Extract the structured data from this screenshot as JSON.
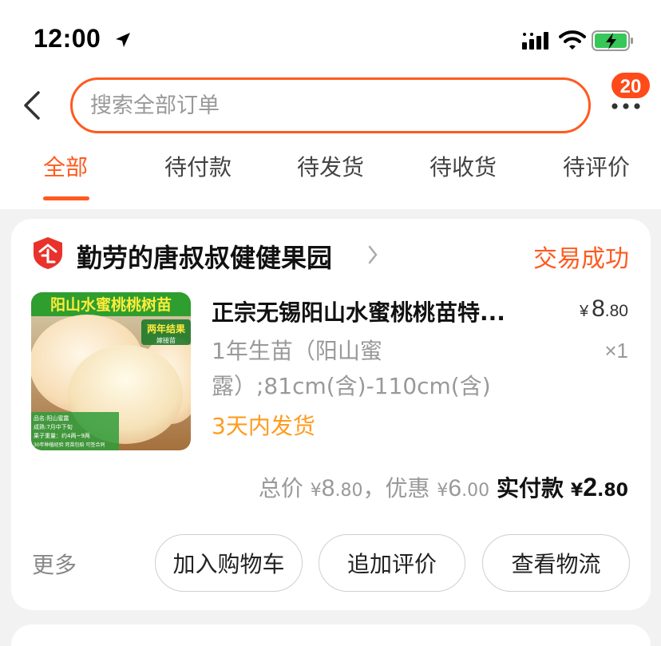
{
  "status_bar": {
    "time": "12:00"
  },
  "header": {
    "search_placeholder": "搜索全部订单",
    "badge_count": "20"
  },
  "tabs": [
    {
      "label": "全部",
      "active": true
    },
    {
      "label": "待付款",
      "active": false
    },
    {
      "label": "待发货",
      "active": false
    },
    {
      "label": "待收货",
      "active": false
    },
    {
      "label": "待评价",
      "active": false
    }
  ],
  "order": {
    "shop_name": "勤劳的唐叔叔健健果园",
    "status": "交易成功",
    "product": {
      "image_banner": "阳山水蜜桃桃树苗",
      "image_tag": "两年结果",
      "image_subtag": "嫁接苗",
      "image_info": [
        "品名:阳山蜜露",
        "成熟:7月中下旬",
        "果子重量：约4两~9两",
        "30年种植经验 死苗包赔 可签合同"
      ],
      "title": "正宗无锡阳山水蜜桃桃苗特...",
      "price_yen": "¥",
      "price_int": "8",
      "price_dec": ".80",
      "sku": "1年生苗（阳山蜜露）;81cm(含)-110cm(含)",
      "quantity": "×1",
      "ship_note": "3天内发货"
    },
    "totals": {
      "total_label": "总价",
      "total_int": "8",
      "total_dec": ".80",
      "discount_label": "，优惠",
      "discount_int": "6",
      "discount_dec": ".00",
      "paid_label": "实付款",
      "paid_int": "2",
      "paid_dec": ".80",
      "yen": "¥"
    },
    "actions": {
      "more": "更多",
      "add_to_cart": "加入购物车",
      "add_review": "追加评价",
      "view_logistics": "查看物流"
    }
  },
  "colors": {
    "accent": "#ff5a1f",
    "ship_note": "#ff9b1f",
    "badge": "#ff4a1a",
    "shop_icon": "#e8322b"
  }
}
